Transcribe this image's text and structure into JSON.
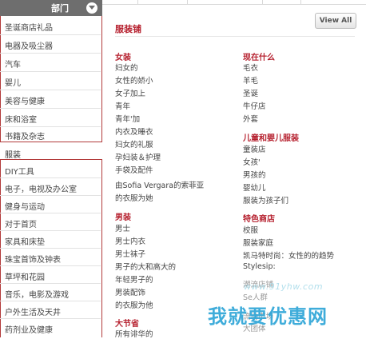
{
  "sidebar": {
    "header_label": "部门",
    "group1": [
      "圣诞商店礼品",
      "电器及吸尘器",
      "汽车",
      "婴儿",
      "美容与健康",
      "床和浴室",
      "书籍及杂志"
    ],
    "selected": "服装",
    "group2": [
      "DIY工具",
      "电子，电视及办公室",
      "健身与运动",
      "对于首页",
      "家具和床垫",
      "珠宝首饰及钟表",
      "草坪和花园",
      "音乐，电影及游戏",
      "户外生活及天井",
      "药剂业及健康"
    ]
  },
  "panel": {
    "view_all": "View All",
    "title": "服装铺",
    "left_column": [
      {
        "title": "女装",
        "links": [
          "妇女的",
          "女性的娇小",
          "女子加上",
          "青年",
          "青年'加",
          "内衣及睡衣",
          "妇女的礼服",
          "孕妇装＆护理",
          "手袋及配件",
          "由Sofia Vergara的索菲亚",
          "的衣服为她"
        ]
      },
      {
        "title": "男装",
        "links": [
          "男士",
          "男士内衣",
          "男士袜子",
          "男子的大和高大的",
          "年轻男子的",
          "男装配饰",
          "的衣服为他"
        ]
      },
      {
        "title": "大节省",
        "links": [
          "所有诽华的"
        ]
      }
    ],
    "right_column": [
      {
        "title": "现在什么",
        "links": [
          "毛衣",
          "羊毛",
          "圣诞",
          "牛仔店",
          "外套"
        ]
      },
      {
        "title": "儿童和婴儿服装",
        "links": [
          "童装店",
          "女孩'",
          "男孩的",
          "婴幼儿",
          "服装为孩子们"
        ]
      },
      {
        "title": "特色商店",
        "links": [
          "校服",
          "服装家庭",
          "凯马特时尚：女性的的趋势",
          "Stylesip:",
          "潮流店铺",
          "Se人群",
          "流动市场",
          "大团体"
        ]
      }
    ]
  },
  "watermark": {
    "url": "www.91yhw.com",
    "text": "我就要优惠网"
  }
}
